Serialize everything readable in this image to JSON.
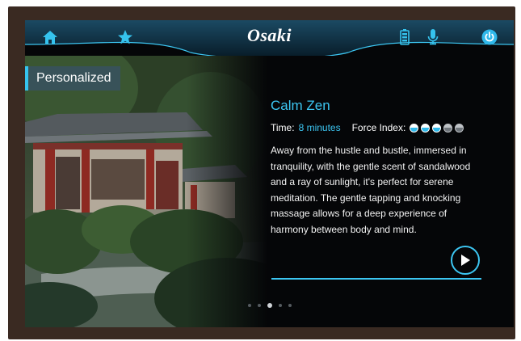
{
  "header": {
    "brand": "Osaki",
    "icons": [
      "home-icon",
      "star-icon",
      "battery-icon",
      "microphone-icon",
      "power-icon"
    ]
  },
  "badge": {
    "label": "Personalized"
  },
  "program": {
    "title": "Calm Zen",
    "time_label": "Time:",
    "time_value": "8 minutes",
    "force_label": "Force Index:",
    "force_level": 3,
    "force_max": 5,
    "description": "Away from the hustle and bustle, immersed in tranquility, with the gentle scent of sandalwood and a ray of sunlight, it's perfect for serene meditation. The gentle tapping and knocking massage allows for a deep experience of harmony between body and mind."
  },
  "pager": {
    "count": 5,
    "active_index": 2
  },
  "colors": {
    "accent": "#3cc6f2",
    "background": "#050608",
    "bezel": "#3a2a22"
  }
}
